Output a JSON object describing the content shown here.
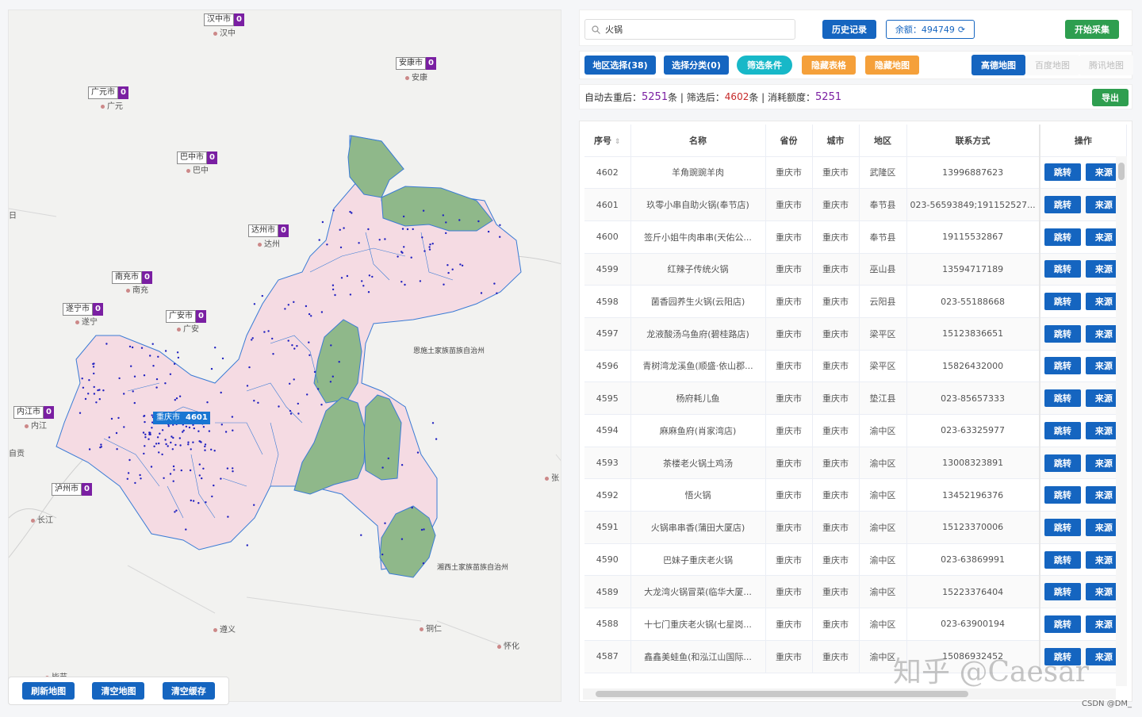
{
  "map": {
    "cities": [
      {
        "name": "汉中市",
        "count": "0"
      },
      {
        "name": "安康市",
        "count": "0"
      },
      {
        "name": "广元市",
        "count": "0"
      },
      {
        "name": "巴中市",
        "count": "0"
      },
      {
        "name": "达州市",
        "count": "0"
      },
      {
        "name": "南充市",
        "count": "0"
      },
      {
        "name": "遂宁市",
        "count": "0"
      },
      {
        "name": "广安市",
        "count": "0"
      },
      {
        "name": "内江市",
        "count": "0"
      },
      {
        "name": "重庆市",
        "count": "4601"
      },
      {
        "name": "泸州市",
        "count": "0"
      }
    ],
    "places": [
      "汉中",
      "安康",
      "广元",
      "巴中",
      "达州",
      "南充",
      "遂宁",
      "广安",
      "内江",
      "长江",
      "遵义",
      "铜仁",
      "怀化",
      "毕节",
      "张"
    ],
    "region_labels": [
      "恩施土家族苗族自治州",
      "湘西土家族苗族自治州"
    ],
    "edge_labels": [
      "日",
      "自贡"
    ],
    "buttons": [
      "刷新地图",
      "清空地图",
      "清空缓存"
    ]
  },
  "search": {
    "value": "火锅"
  },
  "top_buttons": {
    "history": "历史记录",
    "balance": "余额：494749",
    "start": "开始采集"
  },
  "filters": [
    "地区选择(38)",
    "选择分类(0)",
    "筛选条件",
    "隐藏表格",
    "隐藏地图"
  ],
  "map_tabs": [
    "高德地图",
    "百度地图",
    "腾讯地图"
  ],
  "stats": {
    "l1": "自动去重后：",
    "v1": "5251",
    "l2": "条 | 筛选后：",
    "v2": "4602",
    "l3": "条 | 消耗额度：",
    "v3": "5251"
  },
  "export": "导出",
  "table": {
    "headers": [
      "序号",
      "名称",
      "省份",
      "城市",
      "地区",
      "联系方式",
      "操作"
    ],
    "rows": [
      [
        "4602",
        "羊角豌豌羊肉",
        "重庆市",
        "重庆市",
        "武隆区",
        "13996887623"
      ],
      [
        "4601",
        "玖零小串自助火锅(奉节店)",
        "重庆市",
        "重庆市",
        "奉节县",
        "023-56593849;191152527..."
      ],
      [
        "4600",
        "签斤小姐牛肉串串(天佑公...",
        "重庆市",
        "重庆市",
        "奉节县",
        "19115532867"
      ],
      [
        "4599",
        "红辣子传统火锅",
        "重庆市",
        "重庆市",
        "巫山县",
        "13594717189"
      ],
      [
        "4598",
        "菌香园养生火锅(云阳店)",
        "重庆市",
        "重庆市",
        "云阳县",
        "023-55188668"
      ],
      [
        "4597",
        "龙液酸汤乌鱼府(碧桂路店)",
        "重庆市",
        "重庆市",
        "梁平区",
        "15123836651"
      ],
      [
        "4596",
        "青树湾龙溪鱼(顺盛·依山郡...",
        "重庆市",
        "重庆市",
        "梁平区",
        "15826432000"
      ],
      [
        "4595",
        "杨府耗儿鱼",
        "重庆市",
        "重庆市",
        "垫江县",
        "023-85657333"
      ],
      [
        "4594",
        "麻麻鱼府(肖家湾店)",
        "重庆市",
        "重庆市",
        "渝中区",
        "023-63325977"
      ],
      [
        "4593",
        "茶楼老火锅土鸡汤",
        "重庆市",
        "重庆市",
        "渝中区",
        "13008323891"
      ],
      [
        "4592",
        "悟火锅",
        "重庆市",
        "重庆市",
        "渝中区",
        "13452196376"
      ],
      [
        "4591",
        "火锅串串香(蒲田大厦店)",
        "重庆市",
        "重庆市",
        "渝中区",
        "15123370006"
      ],
      [
        "4590",
        "巴妹子重庆老火锅",
        "重庆市",
        "重庆市",
        "渝中区",
        "023-63869991"
      ],
      [
        "4589",
        "大龙湾火锅冒菜(临华大厦...",
        "重庆市",
        "重庆市",
        "渝中区",
        "15223376404"
      ],
      [
        "4588",
        "十七门重庆老火锅(七星岗...",
        "重庆市",
        "重庆市",
        "渝中区",
        "023-63900194"
      ],
      [
        "4587",
        "鑫鑫美蛙鱼(和泓江山国际...",
        "重庆市",
        "重庆市",
        "渝中区",
        "15086932452"
      ]
    ],
    "op_jump": "跳转",
    "op_source": "来源"
  },
  "watermark": "知乎 @Caesar",
  "credit": "CSDN @DM_",
  "colors": {
    "primary": "#1565c0",
    "green": "#2e9e4f",
    "cyan": "#17b8c8",
    "orange": "#f5a03a",
    "purple": "#7a1fa2",
    "region_pink": "#f5dbe3",
    "region_green": "#8fb88a"
  }
}
